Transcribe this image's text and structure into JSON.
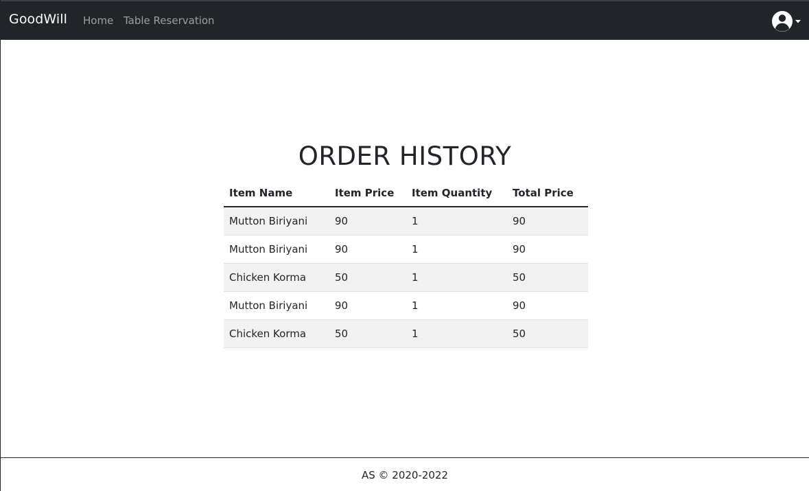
{
  "navbar": {
    "brand": "GoodWill",
    "links": [
      "Home",
      "Table Reservation"
    ],
    "user_icon": "user-circle-icon"
  },
  "main": {
    "title": "ORDER HISTORY",
    "table": {
      "headers": [
        "Item Name",
        "Item Price",
        "Item Quantity",
        "Total Price"
      ],
      "rows": [
        [
          "Mutton Biriyani",
          "90",
          "1",
          "90"
        ],
        [
          "Mutton Biriyani",
          "90",
          "1",
          "90"
        ],
        [
          "Chicken Korma",
          "50",
          "1",
          "50"
        ],
        [
          "Mutton Biriyani",
          "90",
          "1",
          "90"
        ],
        [
          "Chicken Korma",
          "50",
          "1",
          "50"
        ]
      ]
    }
  },
  "footer": {
    "text": "AS © 2020-2022"
  },
  "colors": {
    "navbar_bg": "#212529",
    "stripe": "#f2f2f2"
  }
}
